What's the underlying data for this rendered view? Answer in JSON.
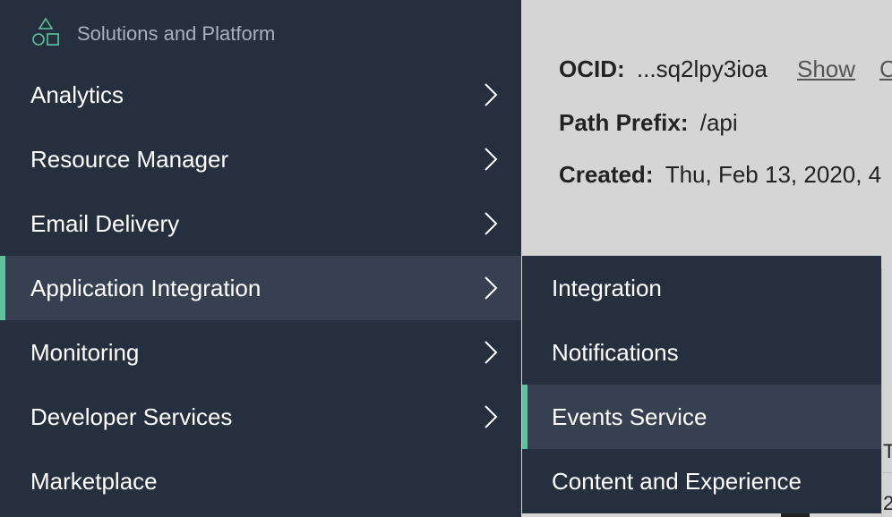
{
  "background": {
    "ocid_label": "OCID:",
    "ocid_value": "...sq2lpy3ioa",
    "show_link": "Show",
    "copy_link_fragment": "C",
    "path_prefix_label": "Path Prefix:",
    "path_prefix_value": "/api",
    "created_label": "Created:",
    "created_value": "Thu, Feb 13, 2020, 4",
    "frag_t": "T",
    "frag_2": "2"
  },
  "menu": {
    "header_label": "Solutions and Platform",
    "items": [
      {
        "label": "Analytics"
      },
      {
        "label": "Resource Manager"
      },
      {
        "label": "Email Delivery"
      },
      {
        "label": "Application Integration"
      },
      {
        "label": "Monitoring"
      },
      {
        "label": "Developer Services"
      },
      {
        "label": "Marketplace"
      }
    ],
    "active_item": "Application Integration"
  },
  "submenu": {
    "items": [
      {
        "label": "Integration"
      },
      {
        "label": "Notifications"
      },
      {
        "label": "Events Service"
      },
      {
        "label": "Content and Experience"
      }
    ],
    "active_item": "Events Service"
  },
  "colors": {
    "menu_bg": "#252f3e",
    "active_bg": "#374050",
    "accent": "#5fc1a0"
  }
}
